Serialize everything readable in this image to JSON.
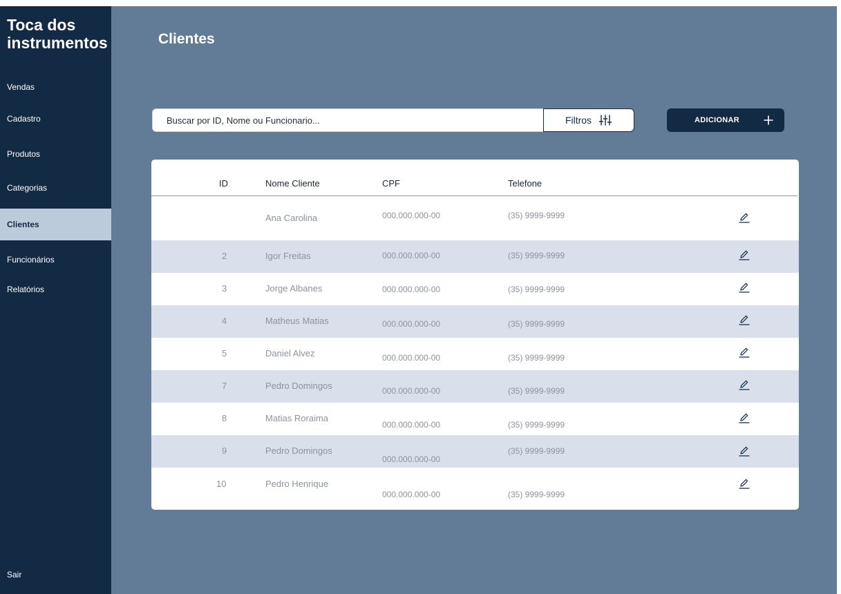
{
  "app": {
    "brand": "Toca dos instrumentos"
  },
  "sidebar": {
    "items": [
      {
        "label": "Vendas"
      },
      {
        "label": "Cadastro"
      },
      {
        "label": "Produtos"
      },
      {
        "label": "Categorias"
      },
      {
        "label": "Clientes",
        "active": true
      },
      {
        "label": "Funcionários"
      },
      {
        "label": "Relatórios"
      }
    ],
    "logout": "Sair"
  },
  "page": {
    "title": "Clientes"
  },
  "toolbar": {
    "search_placeholder": "Buscar por ID, Nome ou Funcionario...",
    "filter_label": "Filtros",
    "add_label": "ADICIONAR"
  },
  "table": {
    "columns": [
      "ID",
      "Nome Cliente",
      "CPF",
      "Telefone"
    ],
    "rows": [
      {
        "id": "",
        "name": "Ana Carolina",
        "cpf": "000.000.000-00",
        "phone": "(35) 9999-9999"
      },
      {
        "id": "2",
        "name": "Igor Freitas",
        "cpf": "000.000.000-00",
        "phone": "(35) 9999-9999"
      },
      {
        "id": "3",
        "name": "Jorge Albanes",
        "cpf": "000.000.000-00",
        "phone": "(35) 9999-9999"
      },
      {
        "id": "4",
        "name": "Matheus Matias",
        "cpf": "000.000.000-00",
        "phone": "(35) 9999-9999"
      },
      {
        "id": "5",
        "name": "Daniel Alvez",
        "cpf": "000.000.000-00",
        "phone": "(35) 9999-9999"
      },
      {
        "id": "7",
        "name": "Pedro Domingos",
        "cpf": "000.000.000-00",
        "phone": "(35) 9999-9999"
      },
      {
        "id": "8",
        "name": "Matias Roraima",
        "cpf": "000.000.000-00",
        "phone": "(35) 9999-9999"
      },
      {
        "id": "9",
        "name": "Pedro Domingos",
        "cpf": "000.000.000-00",
        "phone": "(35) 9999-9999"
      },
      {
        "id": "10",
        "name": "Pedro Henrique",
        "cpf": "000.000.000-00",
        "phone": "(35) 9999-9999"
      }
    ]
  },
  "colors": {
    "sidebar": "#132a45",
    "background": "#627c97",
    "active_item": "#bccbdc",
    "row_alt": "#d9e0eb"
  },
  "icons": {
    "filter": "sliders-icon",
    "add": "plus-icon",
    "edit": "pencil-icon"
  }
}
